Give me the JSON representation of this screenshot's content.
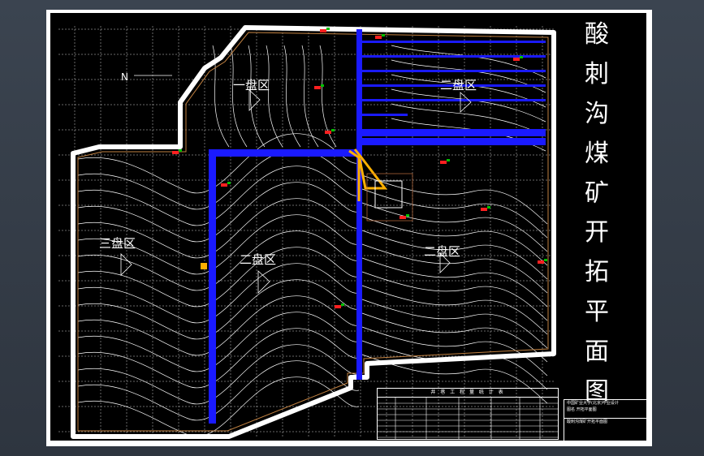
{
  "drawing": {
    "title_chars": [
      "酸",
      "刺",
      "沟",
      "煤",
      "矿",
      "开",
      "拓",
      "平",
      "面",
      "图"
    ],
    "zones": {
      "zone_1": "一盘区",
      "zone_2": "二盘区",
      "zone_3": "三盘区",
      "zone_4": "二盘区"
    },
    "north_label": "N",
    "colors": {
      "background": "#000000",
      "contour": "#ffffff",
      "roadway": "#1a1aff",
      "boundary": "#ffffff",
      "shaft": "#ffb000",
      "marker": "#ff2020",
      "marker_green": "#00c000"
    }
  },
  "legend": {
    "header": "井 巷 工 程 量 统 计 表"
  },
  "title_block": {
    "line1": "中国矿业大学(北京)毕业设计",
    "line2": "图名 开拓平面图",
    "line3": "酸刺沟煤矿开拓平面图"
  }
}
